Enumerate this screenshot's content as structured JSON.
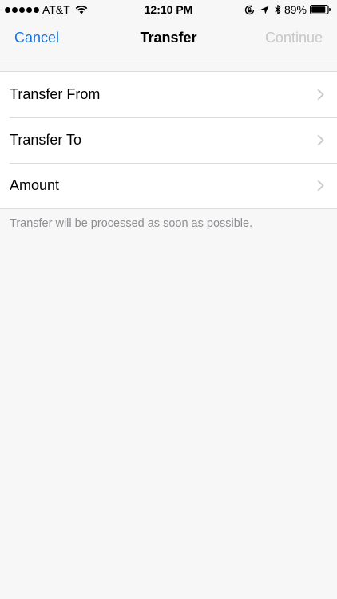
{
  "status_bar": {
    "carrier": "AT&T",
    "time": "12:10 PM",
    "battery_percent": "89%",
    "battery_level": 0.89,
    "icons": [
      "signal-dots-icon",
      "wifi-icon",
      "rotation-lock-icon",
      "location-icon",
      "bluetooth-icon",
      "battery-icon"
    ]
  },
  "nav": {
    "cancel_label": "Cancel",
    "title": "Transfer",
    "continue_label": "Continue"
  },
  "rows": [
    {
      "label": "Transfer From"
    },
    {
      "label": "Transfer To"
    },
    {
      "label": "Amount"
    }
  ],
  "footer_note": "Transfer will be processed as soon as possible.",
  "colors": {
    "accent": "#1a73d9",
    "disabled": "#c7c7cc",
    "background": "#f7f7f7",
    "secondary_text": "#8e8e93"
  }
}
